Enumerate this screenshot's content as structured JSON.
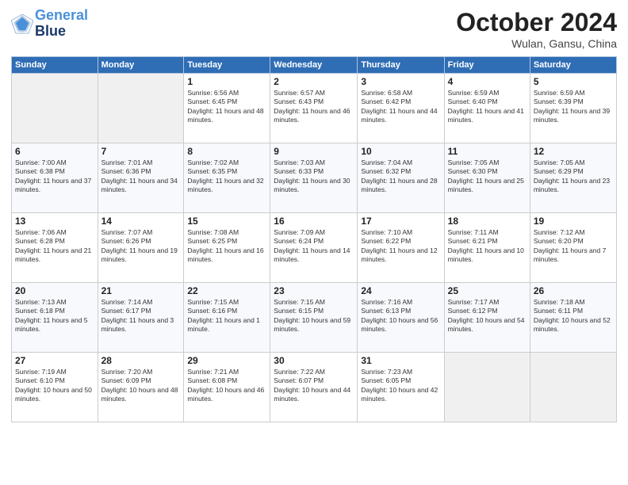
{
  "logo": {
    "line1": "General",
    "line2": "Blue"
  },
  "title": "October 2024",
  "subtitle": "Wulan, Gansu, China",
  "days_header": [
    "Sunday",
    "Monday",
    "Tuesday",
    "Wednesday",
    "Thursday",
    "Friday",
    "Saturday"
  ],
  "weeks": [
    [
      {
        "num": "",
        "info": "",
        "empty": true
      },
      {
        "num": "",
        "info": "",
        "empty": true
      },
      {
        "num": "1",
        "info": "Sunrise: 6:56 AM\nSunset: 6:45 PM\nDaylight: 11 hours and 48 minutes.",
        "empty": false
      },
      {
        "num": "2",
        "info": "Sunrise: 6:57 AM\nSunset: 6:43 PM\nDaylight: 11 hours and 46 minutes.",
        "empty": false
      },
      {
        "num": "3",
        "info": "Sunrise: 6:58 AM\nSunset: 6:42 PM\nDaylight: 11 hours and 44 minutes.",
        "empty": false
      },
      {
        "num": "4",
        "info": "Sunrise: 6:59 AM\nSunset: 6:40 PM\nDaylight: 11 hours and 41 minutes.",
        "empty": false
      },
      {
        "num": "5",
        "info": "Sunrise: 6:59 AM\nSunset: 6:39 PM\nDaylight: 11 hours and 39 minutes.",
        "empty": false
      }
    ],
    [
      {
        "num": "6",
        "info": "Sunrise: 7:00 AM\nSunset: 6:38 PM\nDaylight: 11 hours and 37 minutes.",
        "empty": false
      },
      {
        "num": "7",
        "info": "Sunrise: 7:01 AM\nSunset: 6:36 PM\nDaylight: 11 hours and 34 minutes.",
        "empty": false
      },
      {
        "num": "8",
        "info": "Sunrise: 7:02 AM\nSunset: 6:35 PM\nDaylight: 11 hours and 32 minutes.",
        "empty": false
      },
      {
        "num": "9",
        "info": "Sunrise: 7:03 AM\nSunset: 6:33 PM\nDaylight: 11 hours and 30 minutes.",
        "empty": false
      },
      {
        "num": "10",
        "info": "Sunrise: 7:04 AM\nSunset: 6:32 PM\nDaylight: 11 hours and 28 minutes.",
        "empty": false
      },
      {
        "num": "11",
        "info": "Sunrise: 7:05 AM\nSunset: 6:30 PM\nDaylight: 11 hours and 25 minutes.",
        "empty": false
      },
      {
        "num": "12",
        "info": "Sunrise: 7:05 AM\nSunset: 6:29 PM\nDaylight: 11 hours and 23 minutes.",
        "empty": false
      }
    ],
    [
      {
        "num": "13",
        "info": "Sunrise: 7:06 AM\nSunset: 6:28 PM\nDaylight: 11 hours and 21 minutes.",
        "empty": false
      },
      {
        "num": "14",
        "info": "Sunrise: 7:07 AM\nSunset: 6:26 PM\nDaylight: 11 hours and 19 minutes.",
        "empty": false
      },
      {
        "num": "15",
        "info": "Sunrise: 7:08 AM\nSunset: 6:25 PM\nDaylight: 11 hours and 16 minutes.",
        "empty": false
      },
      {
        "num": "16",
        "info": "Sunrise: 7:09 AM\nSunset: 6:24 PM\nDaylight: 11 hours and 14 minutes.",
        "empty": false
      },
      {
        "num": "17",
        "info": "Sunrise: 7:10 AM\nSunset: 6:22 PM\nDaylight: 11 hours and 12 minutes.",
        "empty": false
      },
      {
        "num": "18",
        "info": "Sunrise: 7:11 AM\nSunset: 6:21 PM\nDaylight: 11 hours and 10 minutes.",
        "empty": false
      },
      {
        "num": "19",
        "info": "Sunrise: 7:12 AM\nSunset: 6:20 PM\nDaylight: 11 hours and 7 minutes.",
        "empty": false
      }
    ],
    [
      {
        "num": "20",
        "info": "Sunrise: 7:13 AM\nSunset: 6:18 PM\nDaylight: 11 hours and 5 minutes.",
        "empty": false
      },
      {
        "num": "21",
        "info": "Sunrise: 7:14 AM\nSunset: 6:17 PM\nDaylight: 11 hours and 3 minutes.",
        "empty": false
      },
      {
        "num": "22",
        "info": "Sunrise: 7:15 AM\nSunset: 6:16 PM\nDaylight: 11 hours and 1 minute.",
        "empty": false
      },
      {
        "num": "23",
        "info": "Sunrise: 7:15 AM\nSunset: 6:15 PM\nDaylight: 10 hours and 59 minutes.",
        "empty": false
      },
      {
        "num": "24",
        "info": "Sunrise: 7:16 AM\nSunset: 6:13 PM\nDaylight: 10 hours and 56 minutes.",
        "empty": false
      },
      {
        "num": "25",
        "info": "Sunrise: 7:17 AM\nSunset: 6:12 PM\nDaylight: 10 hours and 54 minutes.",
        "empty": false
      },
      {
        "num": "26",
        "info": "Sunrise: 7:18 AM\nSunset: 6:11 PM\nDaylight: 10 hours and 52 minutes.",
        "empty": false
      }
    ],
    [
      {
        "num": "27",
        "info": "Sunrise: 7:19 AM\nSunset: 6:10 PM\nDaylight: 10 hours and 50 minutes.",
        "empty": false
      },
      {
        "num": "28",
        "info": "Sunrise: 7:20 AM\nSunset: 6:09 PM\nDaylight: 10 hours and 48 minutes.",
        "empty": false
      },
      {
        "num": "29",
        "info": "Sunrise: 7:21 AM\nSunset: 6:08 PM\nDaylight: 10 hours and 46 minutes.",
        "empty": false
      },
      {
        "num": "30",
        "info": "Sunrise: 7:22 AM\nSunset: 6:07 PM\nDaylight: 10 hours and 44 minutes.",
        "empty": false
      },
      {
        "num": "31",
        "info": "Sunrise: 7:23 AM\nSunset: 6:05 PM\nDaylight: 10 hours and 42 minutes.",
        "empty": false
      },
      {
        "num": "",
        "info": "",
        "empty": true
      },
      {
        "num": "",
        "info": "",
        "empty": true
      }
    ]
  ]
}
